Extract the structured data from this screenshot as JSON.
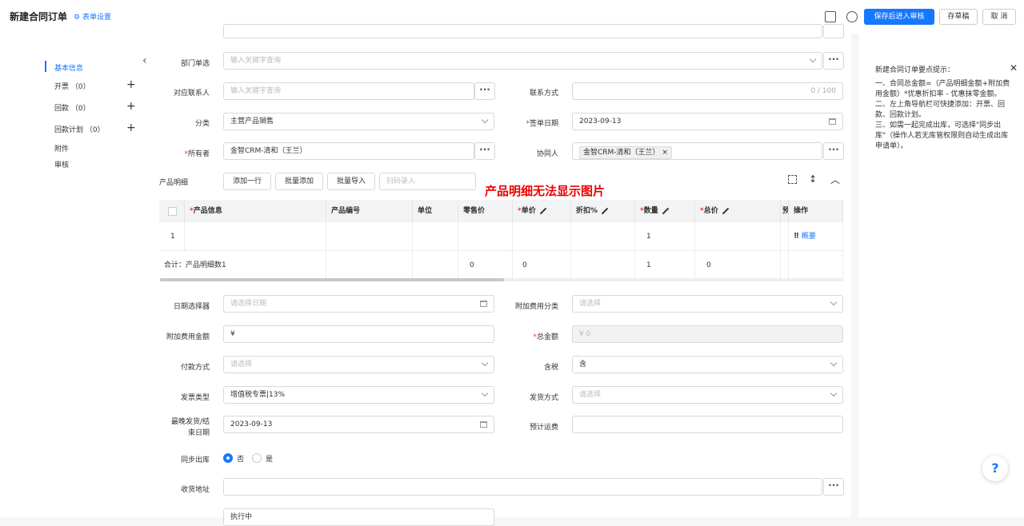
{
  "header": {
    "title": "新建合同订单",
    "form_settings": "表单设置",
    "save_submit": "保存后进入审核",
    "save_draft": "存草稿",
    "cancel": "取 消"
  },
  "sidebar": {
    "items": [
      {
        "label": "基本信息"
      },
      {
        "label": "开票 （0）"
      },
      {
        "label": "回款 （0）"
      },
      {
        "label": "回款计划 （0）"
      },
      {
        "label": "附件"
      },
      {
        "label": "审核"
      }
    ]
  },
  "form": {
    "dept_label": "部门单选",
    "dept_placeholder": "输入关键字查询",
    "contact_label": "对应联系人",
    "contact_placeholder": "输入关键字查询",
    "phone_label": "联系方式",
    "phone_counter": "0 / 100",
    "category_label": "分类",
    "category_value": "主营产品销售",
    "sign_date_label": "签单日期",
    "sign_date_value": "2023-09-13",
    "owner_label": "所有者",
    "owner_value": "金智CRM-清和（王兰）",
    "collab_label": "协同人",
    "collab_tag": "金智CRM-清和（王兰）"
  },
  "product": {
    "section_label": "产品明细",
    "add_row": "添加一行",
    "batch_add": "批量添加",
    "batch_import": "批量导入",
    "scan_placeholder": "扫码录入",
    "warning": "产品明细无法显示图片",
    "columns": [
      "产品信息",
      "产品编号",
      "单位",
      "零售价",
      "单价",
      "折扣%",
      "数量",
      "总价",
      "预",
      "操作"
    ],
    "row": {
      "index": "1",
      "qty": "1",
      "action": "概要"
    },
    "total": {
      "label": "合计：产品明细数1",
      "retail": "0",
      "price": "0",
      "qty": "1",
      "sum": "0"
    }
  },
  "form2": {
    "date_picker_label": "日期选择器",
    "date_picker_placeholder": "请选择日期",
    "extra_fee_cat_label": "附加费用分类",
    "extra_fee_cat_placeholder": "请选择",
    "extra_fee_amt_label": "附加费用金额",
    "extra_fee_amt_value": "¥",
    "total_label": "总金额",
    "total_value": "¥  0",
    "payment_label": "付款方式",
    "payment_placeholder": "请选择",
    "tax_label": "含税",
    "tax_value": "含",
    "invoice_label": "发票类型",
    "invoice_value": "增值税专票|13%",
    "ship_label": "发货方式",
    "ship_placeholder": "请选择",
    "latest_ship_label_1": "最晚发货/结",
    "latest_ship_label_2": "束日期",
    "latest_ship_value": "2023-09-13",
    "freight_label": "预计运费",
    "sync_label": "同步出库",
    "sync_no": "否",
    "sync_yes": "是",
    "address_label": "收货地址",
    "status_value": "执行中"
  },
  "tips": {
    "title": "新建合同订单要点提示：",
    "line1": "一、合同总金额=（产品明细金额+附加费用金额）*优惠折扣率 - 优惠抹零金额。",
    "line2": "二、左上角导航栏可快捷添加：开票、回款、回款计划。",
    "line3": "三、如需一起完成出库，可选择\"同步出库\"（操作人若无库管权限则自动生成出库申请单）。"
  },
  "colors": {
    "accent": "#1677ff",
    "warning": "#e00000"
  }
}
